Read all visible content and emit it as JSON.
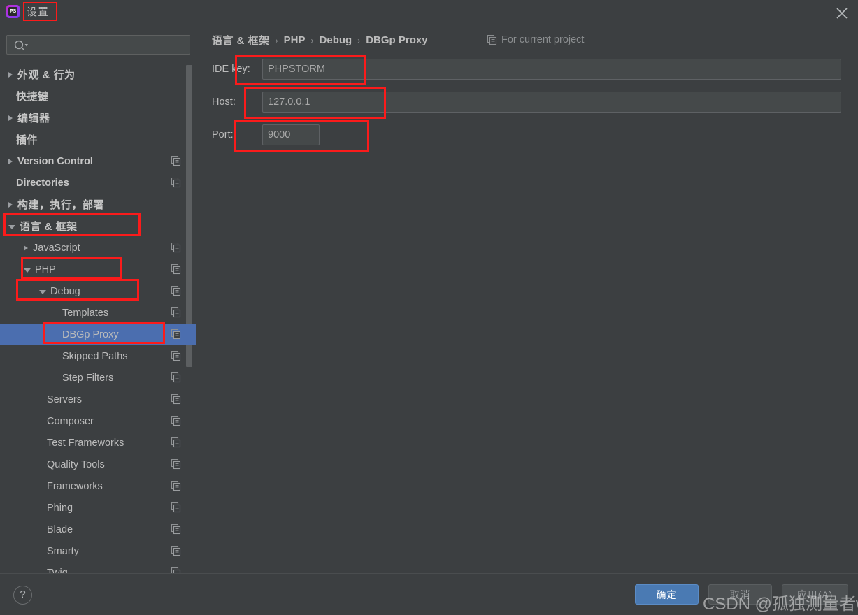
{
  "window": {
    "title": "设置",
    "logo_icon": "phpstorm-logo",
    "logo_text": "PS",
    "close_icon": "close-icon"
  },
  "search": {
    "placeholder": "",
    "value": "",
    "icon": "search-icon"
  },
  "sidebar": {
    "scrollbar": "vertical-scrollbar",
    "items": [
      {
        "label": "外观 & 行为",
        "indent": 0,
        "twisty": "collapsed",
        "bold": true,
        "cn": true,
        "copy": false,
        "selected": false
      },
      {
        "label": "快捷键",
        "indent": 0,
        "twisty": "none",
        "bold": true,
        "cn": true,
        "copy": false,
        "selected": false
      },
      {
        "label": "编辑器",
        "indent": 0,
        "twisty": "collapsed",
        "bold": true,
        "cn": true,
        "copy": false,
        "selected": false
      },
      {
        "label": "插件",
        "indent": 0,
        "twisty": "none",
        "bold": true,
        "cn": true,
        "copy": false,
        "selected": false
      },
      {
        "label": "Version Control",
        "indent": 0,
        "twisty": "collapsed",
        "bold": true,
        "cn": false,
        "copy": true,
        "selected": false
      },
      {
        "label": "Directories",
        "indent": 0,
        "twisty": "none",
        "bold": true,
        "cn": false,
        "copy": true,
        "selected": false
      },
      {
        "label": "构建，执行，部署",
        "indent": 0,
        "twisty": "collapsed",
        "bold": true,
        "cn": true,
        "copy": false,
        "selected": false
      },
      {
        "label": "语言 & 框架",
        "indent": 0,
        "twisty": "open",
        "bold": true,
        "cn": true,
        "copy": false,
        "selected": false
      },
      {
        "label": "JavaScript",
        "indent": 1,
        "twisty": "collapsed",
        "bold": false,
        "cn": false,
        "copy": true,
        "selected": false
      },
      {
        "label": "PHP",
        "indent": 1,
        "twisty": "open",
        "bold": false,
        "cn": false,
        "copy": true,
        "selected": false
      },
      {
        "label": "Debug",
        "indent": 2,
        "twisty": "open",
        "bold": false,
        "cn": false,
        "copy": true,
        "selected": false
      },
      {
        "label": "Templates",
        "indent": 3,
        "twisty": "none",
        "bold": false,
        "cn": false,
        "copy": true,
        "selected": false
      },
      {
        "label": "DBGp Proxy",
        "indent": 3,
        "twisty": "none",
        "bold": false,
        "cn": false,
        "copy": true,
        "selected": true
      },
      {
        "label": "Skipped Paths",
        "indent": 3,
        "twisty": "none",
        "bold": false,
        "cn": false,
        "copy": true,
        "selected": false
      },
      {
        "label": "Step Filters",
        "indent": 3,
        "twisty": "none",
        "bold": false,
        "cn": false,
        "copy": true,
        "selected": false
      },
      {
        "label": "Servers",
        "indent": 2,
        "twisty": "none",
        "bold": false,
        "cn": false,
        "copy": true,
        "selected": false
      },
      {
        "label": "Composer",
        "indent": 2,
        "twisty": "none",
        "bold": false,
        "cn": false,
        "copy": true,
        "selected": false
      },
      {
        "label": "Test Frameworks",
        "indent": 2,
        "twisty": "none",
        "bold": false,
        "cn": false,
        "copy": true,
        "selected": false
      },
      {
        "label": "Quality Tools",
        "indent": 2,
        "twisty": "none",
        "bold": false,
        "cn": false,
        "copy": true,
        "selected": false
      },
      {
        "label": "Frameworks",
        "indent": 2,
        "twisty": "none",
        "bold": false,
        "cn": false,
        "copy": true,
        "selected": false
      },
      {
        "label": "Phing",
        "indent": 2,
        "twisty": "none",
        "bold": false,
        "cn": false,
        "copy": true,
        "selected": false
      },
      {
        "label": "Blade",
        "indent": 2,
        "twisty": "none",
        "bold": false,
        "cn": false,
        "copy": true,
        "selected": false
      },
      {
        "label": "Smarty",
        "indent": 2,
        "twisty": "none",
        "bold": false,
        "cn": false,
        "copy": true,
        "selected": false
      },
      {
        "label": "Twig",
        "indent": 2,
        "twisty": "none",
        "bold": false,
        "cn": false,
        "copy": true,
        "selected": false
      }
    ]
  },
  "breadcrumb": {
    "separator": "›",
    "items": [
      {
        "label": "语言 & 框架",
        "cn": true
      },
      {
        "label": "PHP",
        "cn": false
      },
      {
        "label": "Debug",
        "cn": false
      },
      {
        "label": "DBGp Proxy",
        "cn": false
      }
    ],
    "scope_label": "For current project",
    "scope_icon": "copy-icon"
  },
  "form": {
    "fields": [
      {
        "label": "IDE key:",
        "value": "PHPSTORM",
        "wide": true
      },
      {
        "label": "Host:",
        "value": "127.0.0.1",
        "wide": true
      },
      {
        "label": "Port:",
        "value": "9000",
        "wide": false
      }
    ]
  },
  "footer": {
    "help_icon": "help-icon",
    "help_label": "?",
    "ok_label": "确定",
    "cancel_label": "取消",
    "apply_label": "应用(A)"
  },
  "watermark": {
    "text": "CSDN @孤独测量者w"
  },
  "colors": {
    "background": "#3c3f41",
    "selection": "#4b6eaf",
    "annotation": "#fb1b1b",
    "primary_button": "#4a7ab3",
    "text": "#bbbbbb",
    "muted_text": "#8a8d8f"
  }
}
